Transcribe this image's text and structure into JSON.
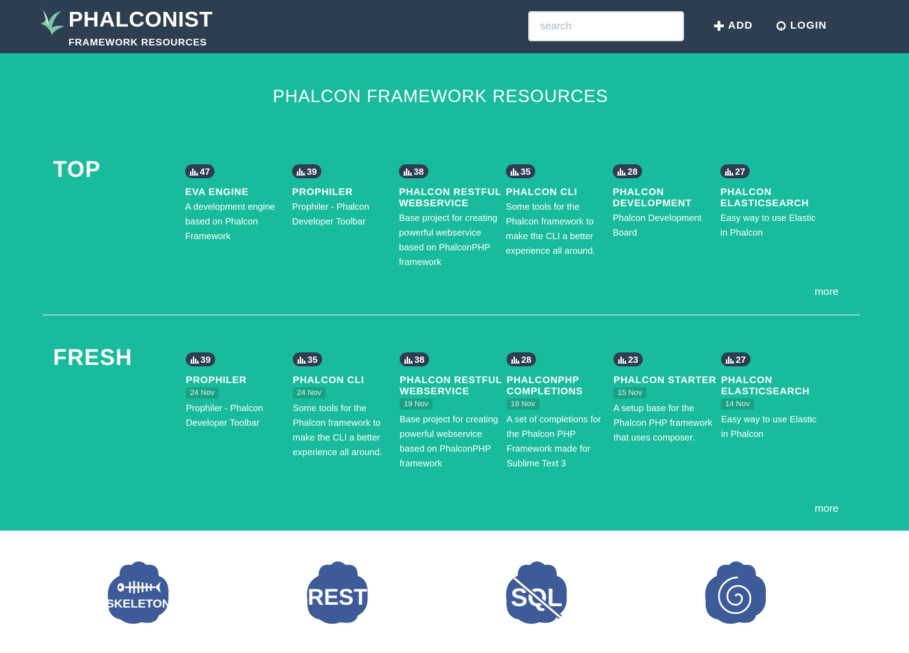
{
  "header": {
    "brand": "PHALCONIST",
    "brand_sub": "FRAMEWORK RESOURCES",
    "search_placeholder": "search",
    "add_label": "ADD",
    "login_label": "LOGIN"
  },
  "main": {
    "title": "PHALCON FRAMEWORK RESOURCES",
    "top": {
      "label": "TOP",
      "more": "more",
      "items": [
        {
          "count": "47",
          "title": "EVA ENGINE",
          "desc": "A development engine based on Phalcon Framework"
        },
        {
          "count": "39",
          "title": "PROPHILER",
          "desc": "Prophiler - Phalcon Developer Toolbar"
        },
        {
          "count": "38",
          "title": "PHALCON RESTFUL WEBSERVICE",
          "desc": "Base project for creating powerful webservice based on PhalconPHP framework"
        },
        {
          "count": "35",
          "title": "PHALCON CLI",
          "desc": "Some tools for the Phalcon framework to make the CLI a better experience all around."
        },
        {
          "count": "28",
          "title": "PHALCON DEVELOPMENT",
          "desc": "Phalcon Development Board"
        },
        {
          "count": "27",
          "title": "PHALCON ELASTICSEARCH",
          "desc": "Easy way to use Elastic in Phalcon"
        }
      ]
    },
    "fresh": {
      "label": "FRESH",
      "more": "more",
      "items": [
        {
          "count": "39",
          "title": "PROPHILER",
          "date": "24 Nov",
          "desc": "Prophiler - Phalcon Developer Toolbar"
        },
        {
          "count": "35",
          "title": "PHALCON CLI",
          "date": "24 Nov",
          "desc": "Some tools for the Phalcon framework to make the CLI a better experience all around."
        },
        {
          "count": "38",
          "title": "PHALCON RESTFUL WEBSERVICE",
          "date": "19 Nov",
          "desc": "Base project for creating powerful webservice based on PhalconPHP framework"
        },
        {
          "count": "28",
          "title": "PHALCONPHP COMPLETIONS",
          "date": "18 Nov",
          "desc": "A set of completions for the Phalcon PHP Framework made for Sublime Text 3"
        },
        {
          "count": "23",
          "title": "PHALCON STARTER",
          "date": "15 Nov",
          "desc": "A setup base for the Phalcon PHP framework that uses composer."
        },
        {
          "count": "27",
          "title": "PHALCON ELASTICSEARCH",
          "date": "14 Nov",
          "desc": "Easy way to use Elastic in Phalcon"
        }
      ]
    }
  },
  "bottom": {
    "icons": [
      {
        "name": "skeleton",
        "label": "SKELETON"
      },
      {
        "name": "rest",
        "label": "REST"
      },
      {
        "name": "nosql",
        "label": "SQL"
      },
      {
        "name": "spiral",
        "label": ""
      }
    ]
  },
  "colors": {
    "header_bg": "#2c3e50",
    "main_bg": "#18bc9c",
    "badge_bg": "#2c3e50",
    "cloud_bg": "#3d5a99"
  },
  "icon_names": [
    "phalcon-logo-icon",
    "plus-icon",
    "github-icon",
    "bar-chart-icon"
  ]
}
